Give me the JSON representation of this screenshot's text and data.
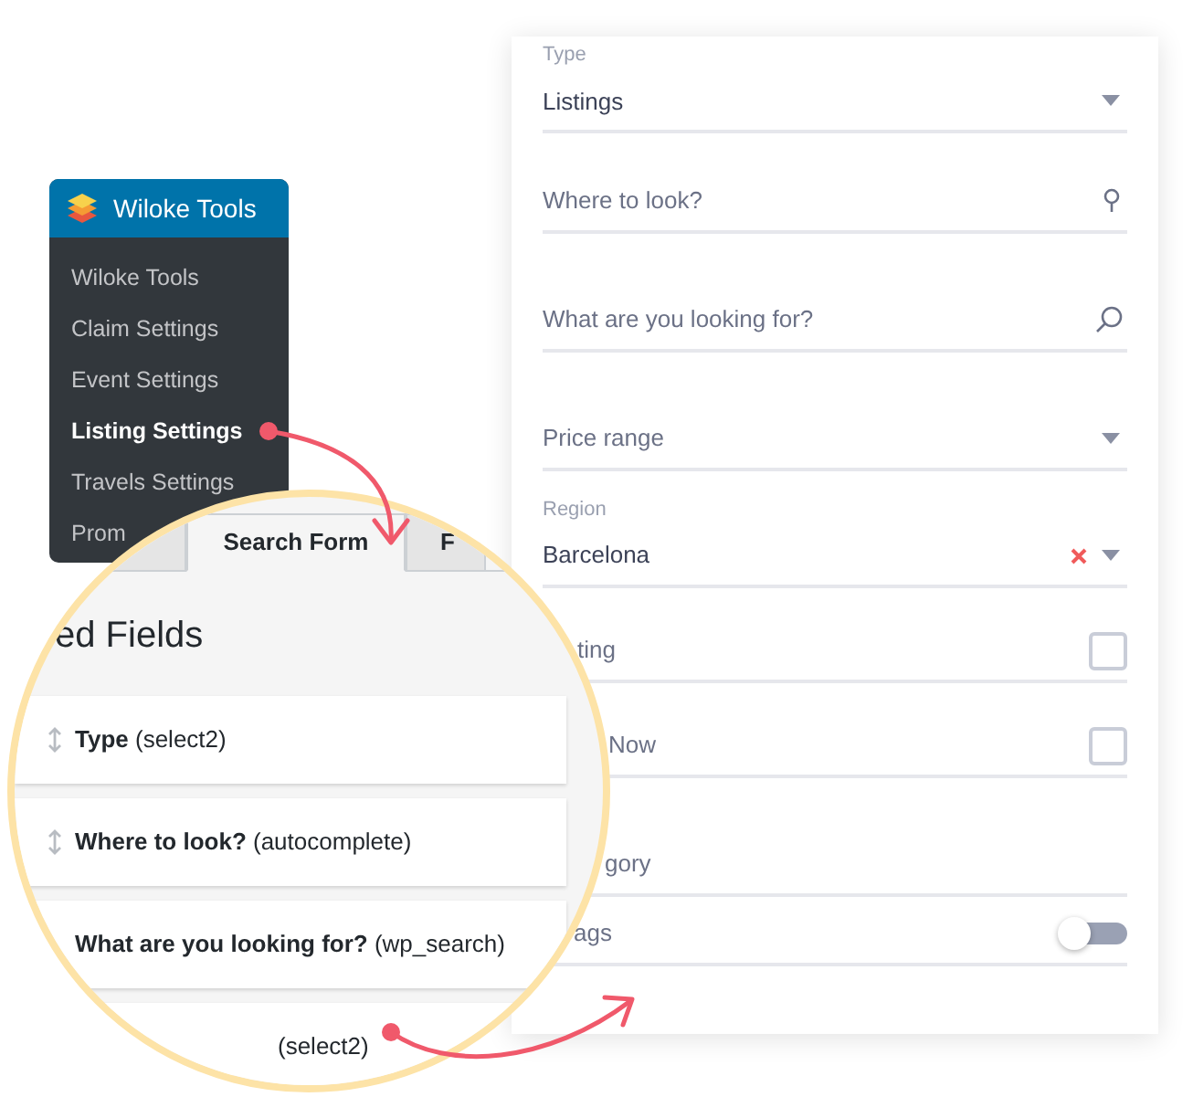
{
  "admin_menu": {
    "title": "Wiloke Tools",
    "items": [
      {
        "label": "Wiloke Tools",
        "selected": false
      },
      {
        "label": "Claim Settings",
        "selected": false
      },
      {
        "label": "Event Settings",
        "selected": false
      },
      {
        "label": "Listing Settings",
        "selected": true
      },
      {
        "label": "Travels Settings",
        "selected": false
      },
      {
        "label": "Prom",
        "selected": false
      }
    ]
  },
  "magnifier": {
    "tabs": [
      {
        "selected": false
      },
      {
        "label": "Search Form",
        "selected": true
      },
      {
        "label": "F",
        "selected": false
      }
    ],
    "heading": "ed Fields",
    "fields": [
      {
        "name": "Type",
        "type": "(select2)",
        "draggable": true
      },
      {
        "name": "Where to look?",
        "type": "(autocomplete)",
        "draggable": true
      },
      {
        "name": "What are you looking for?",
        "type": "(wp_search)",
        "draggable": false
      },
      {
        "type": "(select2)",
        "draggable": false
      }
    ]
  },
  "search_form": {
    "fields": [
      {
        "kind": "select",
        "label": "Type",
        "value": "Listings"
      },
      {
        "kind": "location",
        "placeholder": "Where to look?"
      },
      {
        "kind": "search",
        "placeholder": "What are you looking for?"
      },
      {
        "kind": "select",
        "placeholder": "Price range"
      },
      {
        "kind": "select",
        "label": "Region",
        "value": "Barcelona",
        "clearable": true
      },
      {
        "kind": "checkbox",
        "label": "ting",
        "checked": false
      },
      {
        "kind": "checkbox",
        "label": "Now",
        "checked": false
      },
      {
        "kind": "text",
        "label": "gory"
      },
      {
        "kind": "toggle",
        "label": "ags",
        "on": false
      }
    ]
  }
}
